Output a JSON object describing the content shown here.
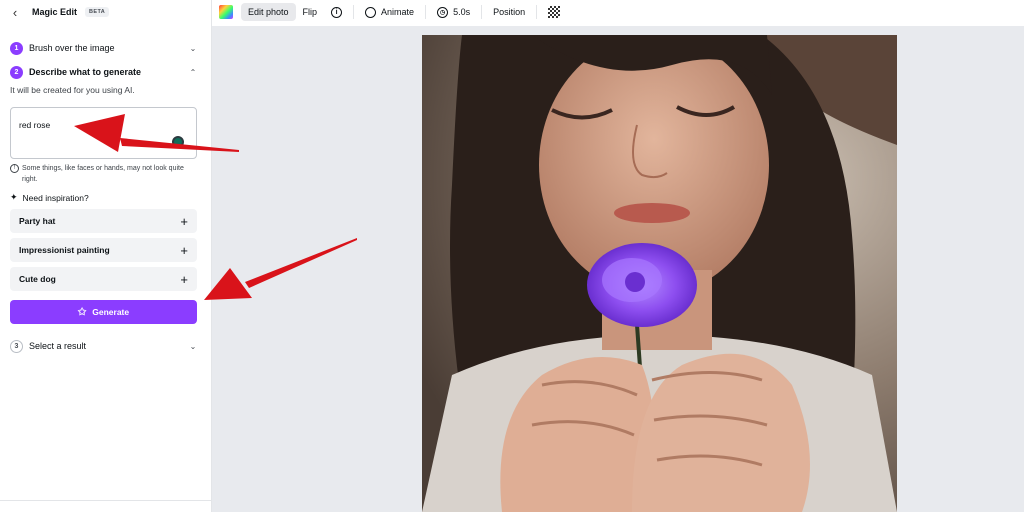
{
  "sidebar": {
    "title": "Magic Edit",
    "badge": "BETA",
    "steps": [
      {
        "num": "1",
        "label": "Brush over the image"
      },
      {
        "num": "2",
        "label": "Describe what to generate"
      },
      {
        "num": "3",
        "label": "Select a result"
      }
    ],
    "helper": "It will be created for you using AI.",
    "prompt_value": "red rose",
    "warning": "Some things, like faces or hands, may not look quite right.",
    "inspiration_label": "Need inspiration?",
    "ideas": [
      "Party hat",
      "Impressionist painting",
      "Cute dog"
    ],
    "generate_label": "Generate"
  },
  "toolbar": {
    "edit_photo": "Edit photo",
    "flip": "Flip",
    "animate": "Animate",
    "duration": "5.0s",
    "position": "Position"
  },
  "colors": {
    "accent": "#8b3dff",
    "flower": "#8e4ff0",
    "arrow": "#d9131a"
  },
  "icons": [
    "back-arrow-icon",
    "chevron-down-icon",
    "chevron-up-icon",
    "info-icon",
    "sparkle-icon",
    "plus-icon",
    "magic-wand-icon",
    "color-swatch-icon",
    "animate-icon",
    "clock-icon",
    "transparency-icon"
  ]
}
